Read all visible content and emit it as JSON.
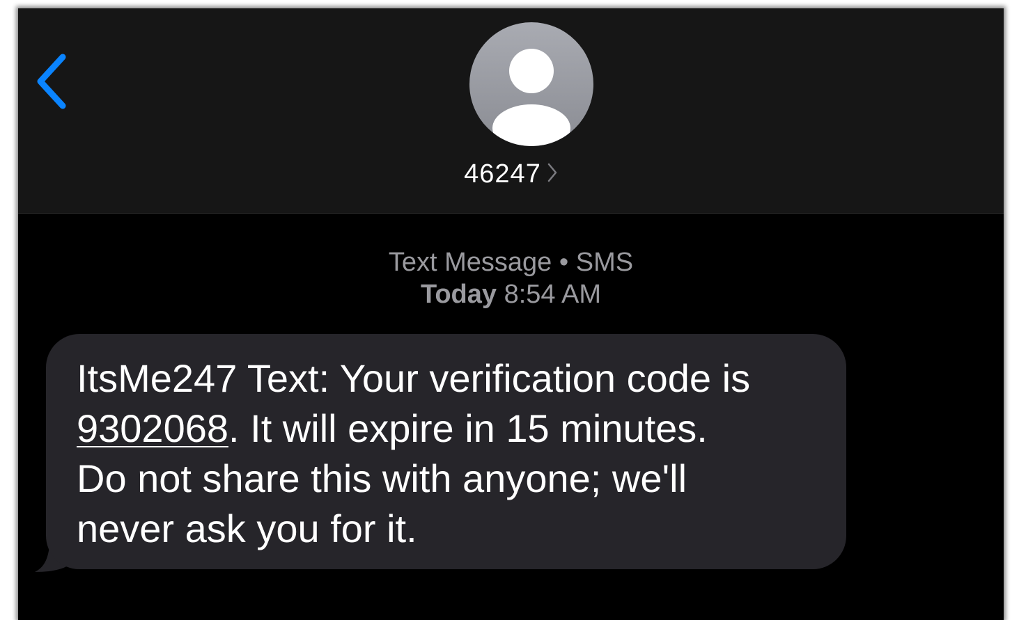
{
  "header": {
    "back_icon": "chevron-left-icon",
    "avatar_icon": "person-icon",
    "contact_name": "46247",
    "contact_chevron_icon": "chevron-right-icon",
    "accent_color": "#0a84ff"
  },
  "thread": {
    "service_label": "Text Message",
    "separator": "•",
    "service_type": "SMS",
    "day": "Today",
    "time": "8:54 AM"
  },
  "message": {
    "line1": "ItsMe247 Text: Your verification code is",
    "code": "9302068",
    "rest": ". It will expire in 15 minutes.",
    "line3": "Do not share this with anyone; we'll",
    "line4": "never ask you for it.",
    "bubble_color": "#26252a"
  }
}
